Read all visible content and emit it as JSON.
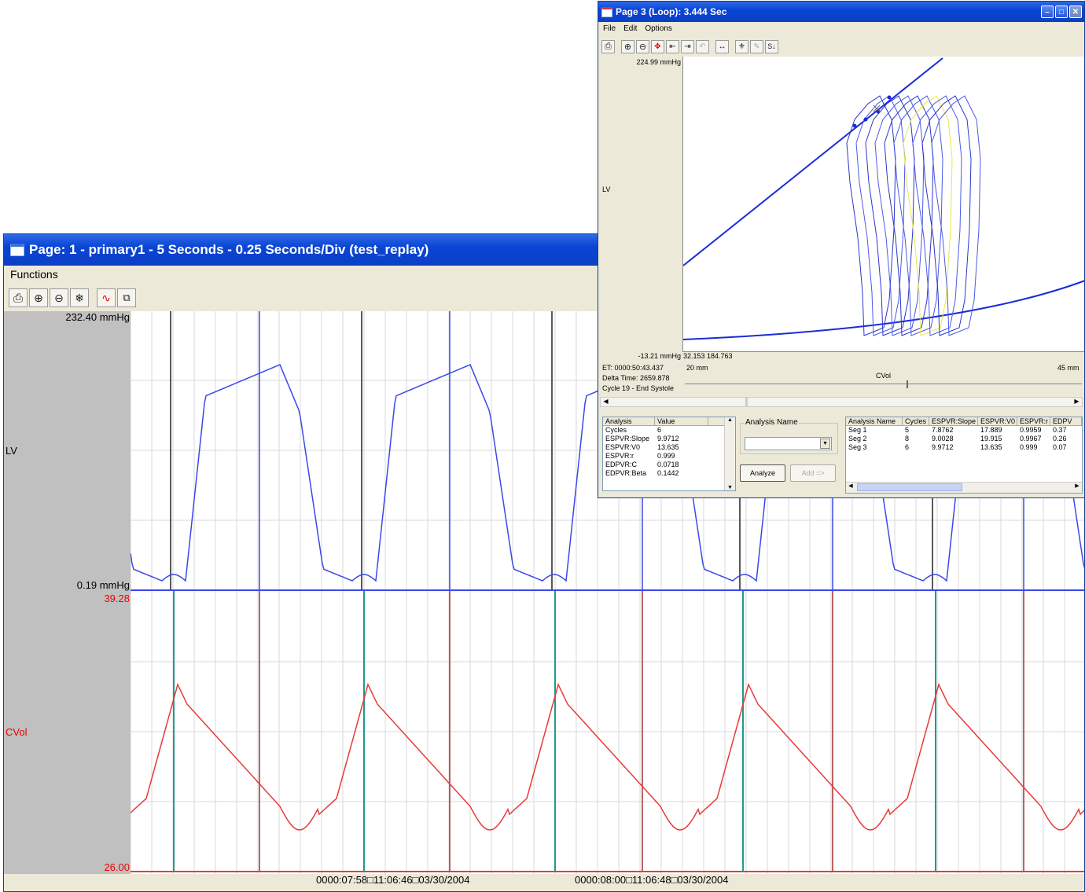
{
  "main": {
    "title": "Page: 1 - primary1 - 5 Seconds - 0.25 Seconds/Div (test_replay)",
    "menu": [
      "Functions"
    ],
    "toolbar_icons": [
      "print-icon",
      "zoom-in-icon",
      "zoom-out-icon",
      "snowflake-icon",
      "waveform-icon",
      "copy-icon"
    ],
    "channels": [
      {
        "name": "LV",
        "top_label": "232.40 mmHg",
        "bottom_label": "0.19 mmHg",
        "color": "#3a48ea"
      },
      {
        "name": "CVol",
        "top_label": "39.28",
        "bottom_label": "26.00",
        "color": "#e83a3a"
      }
    ],
    "time_labels": [
      "0000:07:58□11:06:46□03/30/2004",
      "0000:08:00□11:06:48□03/30/2004"
    ]
  },
  "loop": {
    "title": "Page 3 (Loop): 3.444 Sec",
    "menu": [
      "File",
      "Edit",
      "Options"
    ],
    "y_top": "224.99 mmHg",
    "y_label": "LV",
    "y_bottom": "-13.21 mmHg",
    "readout": "32.153  184.763",
    "x_min": "20 mm",
    "x_max": "45 mm",
    "x_label": "CVol",
    "info": [
      "ET: 0000:50:43.437",
      "Delta Time: 2659.878",
      "Cycle 19 - End Systole"
    ],
    "analysis_table": {
      "headers": [
        "Analysis",
        "Value"
      ],
      "rows": [
        [
          "Cycles",
          "6"
        ],
        [
          "ESPVR:Slope",
          "9.9712"
        ],
        [
          "ESPVR:V0",
          "13.635"
        ],
        [
          "ESPVR:r",
          "0.999"
        ],
        [
          "EDPVR:C",
          "0.0718"
        ],
        [
          "EDPVR:Beta",
          "0.1442"
        ]
      ]
    },
    "analysis_name_label": "Analysis Name",
    "analyze_button": "Analyze",
    "add_button": "Add =>",
    "results_table": {
      "headers": [
        "Analysis Name",
        "Cycles",
        "ESPVR:Slope",
        "ESPVR:V0",
        "ESPVR:r",
        "EDPV"
      ],
      "rows": [
        [
          "Seg 1",
          "5",
          "7.8762",
          "17.889",
          "0.9959",
          "0.37"
        ],
        [
          "Seg 2",
          "8",
          "9.0028",
          "19.915",
          "0.9967",
          "0.26"
        ],
        [
          "Seg 3",
          "6",
          "9.9712",
          "13.635",
          "0.999",
          "0.07"
        ]
      ]
    }
  }
}
